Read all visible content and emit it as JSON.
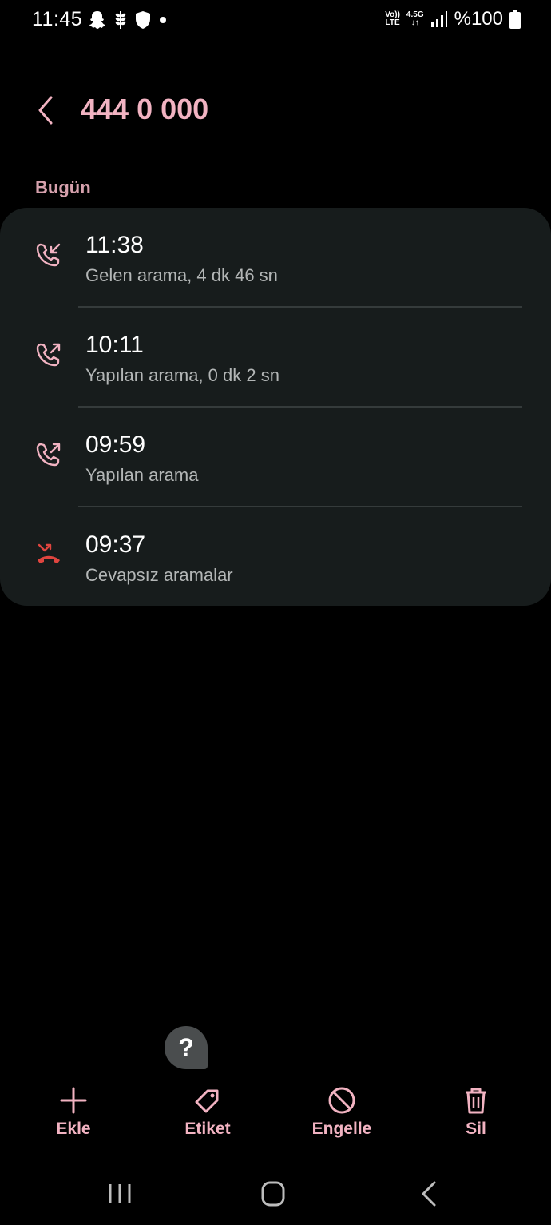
{
  "status_bar": {
    "time": "11:45",
    "left_icons": [
      "snapchat-icon",
      "wheat-icon",
      "shield-icon",
      "dot-icon"
    ],
    "volte_top": "Vo))",
    "volte_bottom": "LTE",
    "network": "4.5G",
    "battery_text": "%100"
  },
  "header": {
    "title": "444 0 000"
  },
  "section": {
    "label": "Bugün"
  },
  "calls": [
    {
      "time": "11:38",
      "description": "Gelen arama, 4 dk 46 sn",
      "type": "incoming"
    },
    {
      "time": "10:11",
      "description": "Yapılan arama, 0 dk 2 sn",
      "type": "outgoing"
    },
    {
      "time": "09:59",
      "description": "Yapılan arama",
      "type": "outgoing"
    },
    {
      "time": "09:37",
      "description": "Cevapsız aramalar",
      "type": "missed"
    }
  ],
  "help": {
    "symbol": "?"
  },
  "actions": [
    {
      "label": "Ekle",
      "icon": "plus-icon"
    },
    {
      "label": "Etiket",
      "icon": "tag-icon"
    },
    {
      "label": "Engelle",
      "icon": "block-icon"
    },
    {
      "label": "Sil",
      "icon": "trash-icon"
    }
  ],
  "colors": {
    "accent": "#f2b3c2",
    "missed": "#e0453f",
    "card": "#171c1c",
    "background": "#000000"
  }
}
